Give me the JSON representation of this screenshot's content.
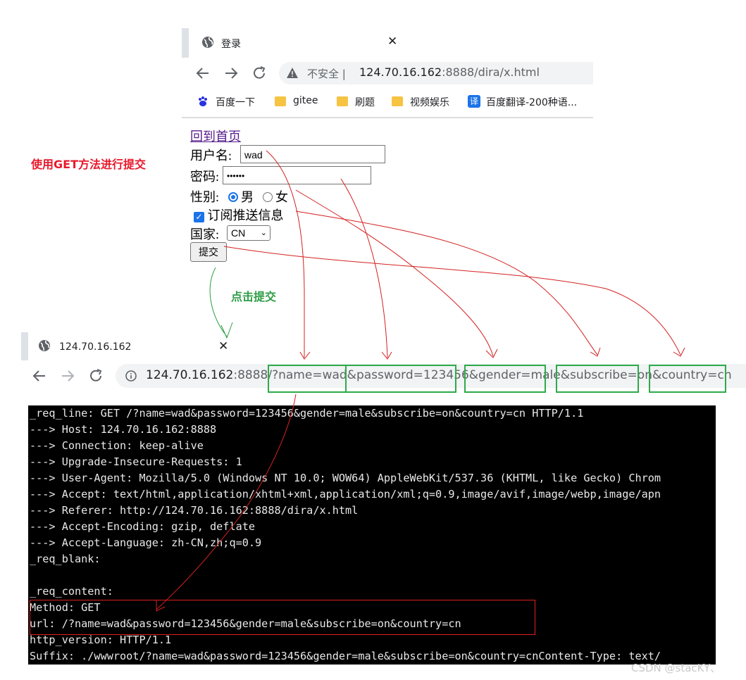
{
  "window1": {
    "tab_title": "登录",
    "security_label": "不安全 |",
    "url_host": "124.70.16.162",
    "url_path": ":8888/dira/x.html",
    "bookmarks": [
      "百度一下",
      "gitee",
      "刷题",
      "视频娱乐",
      "百度翻译-200种语..."
    ],
    "translate_icon_glyph": "译"
  },
  "form": {
    "home_link": "回到首页",
    "username_label": "用户名:",
    "username_value": "wad",
    "password_label": "密码:",
    "password_value": "••••••",
    "gender_label": "性别:",
    "gender_male": "男",
    "gender_female": "女",
    "subscribe_label": "订阅推送信息",
    "country_label": "国家:",
    "country_value": "CN",
    "submit_label": "提交"
  },
  "annotations": {
    "get_method_note": "使用GET方法进行提交",
    "click_submit_note": "点击提交",
    "watermark": "CSDN @stacKY、"
  },
  "window2": {
    "tab_title": "124.70.16.162",
    "url_host": "124.70.16.162",
    "url_path": ":8888/?name=wad&password=123456&gender=male&subscribe=on&country=cn",
    "highlighted_params": [
      "name=wad",
      "password=123456",
      "gender=male",
      "subscribe=on",
      "country=cn"
    ]
  },
  "terminal": {
    "lines": [
      "_req_line: GET /?name=wad&password=123456&gender=male&subscribe=on&country=cn HTTP/1.1",
      "---> Host: 124.70.16.162:8888",
      "---> Connection: keep-alive",
      "---> Upgrade-Insecure-Requests: 1",
      "---> User-Agent: Mozilla/5.0 (Windows NT 10.0; WOW64) AppleWebKit/537.36 (KHTML, like Gecko) Chrom",
      "---> Accept: text/html,application/xhtml+xml,application/xml;q=0.9,image/avif,image/webp,image/apn",
      "---> Referer: http://124.70.16.162:8888/dira/x.html",
      "---> Accept-Encoding: gzip, deflate",
      "---> Accept-Language: zh-CN,zh;q=0.9",
      "_req_blank:",
      "",
      "_req_content:",
      "Method: GET",
      "url: /?name=wad&password=123456&gender=male&subscribe=on&country=cn",
      "http_version: HTTP/1.1",
      "Suffix: ./wwwroot/?name=wad&password=123456&gender=male&subscribe=on&country=cnContent-Type: text/"
    ]
  },
  "colors": {
    "annotation_red": "#e8192c",
    "annotation_green": "#2e9e47",
    "highlight_box": "#2eaa4a",
    "terminal_bg": "#000000",
    "link": "#551a8b",
    "accent_blue": "#1a73e8"
  }
}
